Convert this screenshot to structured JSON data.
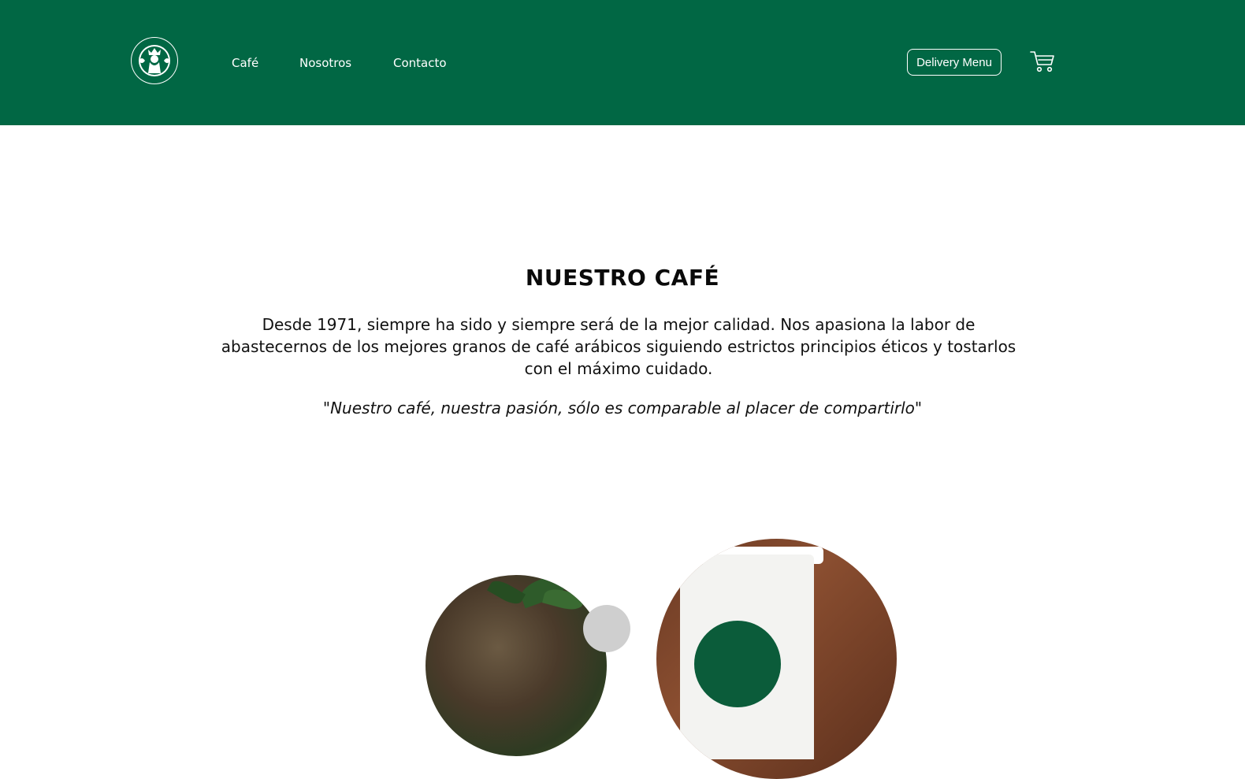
{
  "header": {
    "logo_icon": "siren-logo-icon",
    "background_color": "#016744",
    "nav": [
      {
        "label": "Café"
      },
      {
        "label": "Nosotros"
      },
      {
        "label": "Contacto"
      }
    ],
    "delivery_button": "Delivery Menu",
    "cart_icon": "shopping-cart-icon"
  },
  "main": {
    "title": "NUESTRO CAFÉ",
    "description": "Desde 1971, siempre ha sido y siempre será de la mejor calidad. Nos apasiona la labor de abastecernos de los mejores granos de café arábicos siguiendo estrictos principios éticos y tostarlos con el máximo cuidado.",
    "quote": "\"Nuestro café, nuestra pasión, sólo es comparable al placer de compartirlo\""
  }
}
